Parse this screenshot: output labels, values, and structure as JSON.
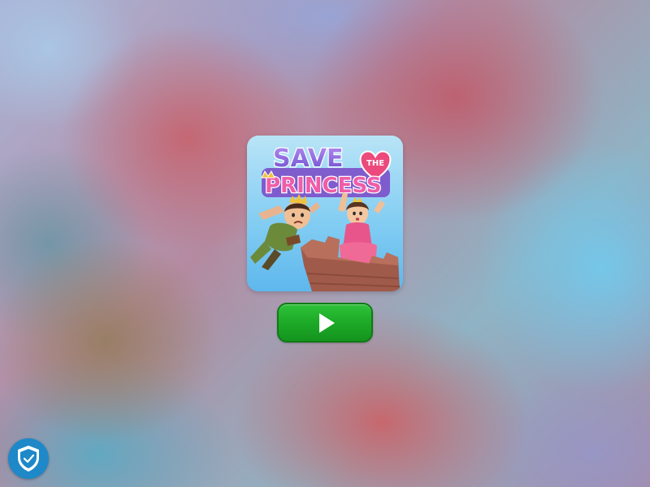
{
  "game": {
    "title_line1": "SAVE",
    "title_connector": "THE",
    "title_line2": "PRINCESS"
  },
  "play_button": {
    "icon": "play-icon",
    "color": "#1daa27"
  },
  "privacy_badge": {
    "icon": "shield-check-icon",
    "color": "#1e88c8"
  }
}
